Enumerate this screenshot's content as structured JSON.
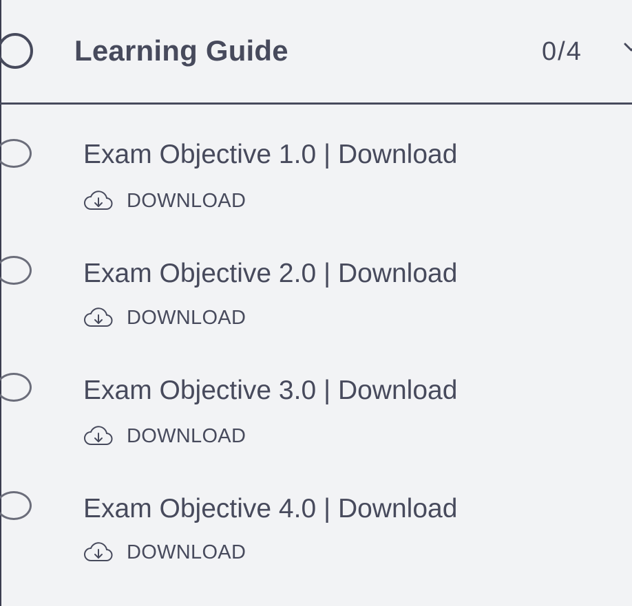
{
  "section": {
    "title": "Learning Guide",
    "progress": "0/4"
  },
  "items": [
    {
      "title": "Exam Objective 1.0 | Download",
      "download_label": "DOWNLOAD"
    },
    {
      "title": "Exam Objective 2.0 | Download",
      "download_label": "DOWNLOAD"
    },
    {
      "title": "Exam Objective 3.0 | Download",
      "download_label": "DOWNLOAD"
    },
    {
      "title": "Exam Objective 4.0 | Download",
      "download_label": "DOWNLOAD"
    }
  ],
  "icons": {
    "status": "circle-outline-icon",
    "download": "cloud-download-icon",
    "expand": "chevron-down-icon"
  },
  "colors": {
    "background": "#f2f3f5",
    "text": "#474a5c",
    "divider": "#474a5c"
  }
}
